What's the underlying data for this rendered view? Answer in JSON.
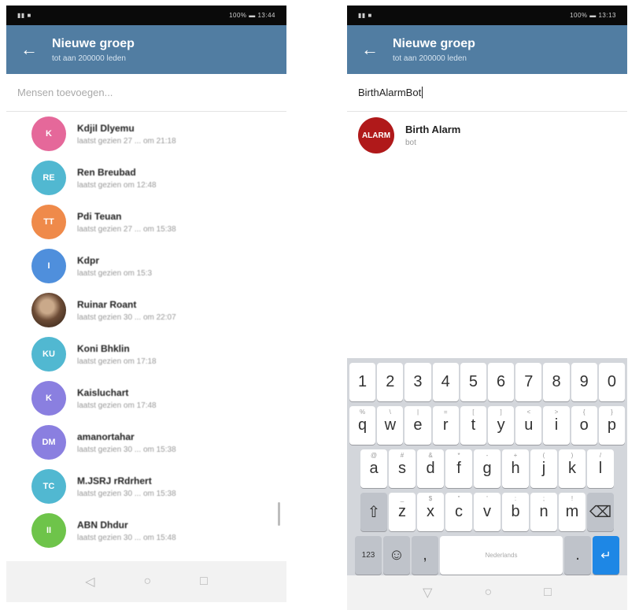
{
  "left_screen": {
    "statusbar": {
      "left": "▮▮ ■",
      "right": "100% ▬ 13:44"
    },
    "header": {
      "title": "Nieuwe groep",
      "subtitle": "tot aan 200000 leden"
    },
    "search": {
      "placeholder": "Mensen toevoegen..."
    },
    "contacts": [
      {
        "initials": "K",
        "color": "#e5689a",
        "name": "Kdjil Dlyemu",
        "status": "laatst gezien 27 ... om 21:18"
      },
      {
        "initials": "RE",
        "color": "#51b8d1",
        "name": "Ren Breubad",
        "status": "laatst gezien om 12:48"
      },
      {
        "initials": "TT",
        "color": "#ef8a4a",
        "name": "Pdi Teuan",
        "status": "laatst gezien 27 ... om 15:38"
      },
      {
        "initials": "I",
        "color": "#4f8fdc",
        "name": "Kdpr",
        "status": "laatst gezien om 15:3"
      },
      {
        "initials": "",
        "color": "",
        "name": "Ruinar Roant",
        "status": "laatst gezien 30 ... om 22:07"
      },
      {
        "initials": "KU",
        "color": "#51b8d1",
        "name": "Koni Bhklin",
        "status": "laatst gezien om 17:18"
      },
      {
        "initials": "K",
        "color": "#8a7fe0",
        "name": "Kaisluchart",
        "status": "laatst gezien om 17:48"
      },
      {
        "initials": "DM",
        "color": "#8a7fe0",
        "name": "amanortahar",
        "status": "laatst gezien 30 ... om 15:38"
      },
      {
        "initials": "TC",
        "color": "#51b8d1",
        "name": "M.JSRJ rRdrhert",
        "status": "laatst gezien 30 ... om 15:38"
      },
      {
        "initials": "II",
        "color": "#6ec44a",
        "name": "ABN Dhdur",
        "status": "laatst gezien 30 ... om 15:48"
      }
    ],
    "nav": {
      "back": "◁",
      "home": "○",
      "recent": "□"
    }
  },
  "right_screen": {
    "statusbar": {
      "left": "▮▮ ■",
      "right": "100% ▬ 13:13"
    },
    "header": {
      "title": "Nieuwe groep",
      "subtitle": "tot aan 200000 leden"
    },
    "search": {
      "value": "BirthAlarmBot"
    },
    "result": {
      "avatar_text": "ALARM",
      "name": "Birth Alarm",
      "subtitle": "bot"
    },
    "keyboard": {
      "numbers": [
        "1",
        "2",
        "3",
        "4",
        "5",
        "6",
        "7",
        "8",
        "9",
        "0"
      ],
      "row1": [
        {
          "k": "q",
          "h": "%"
        },
        {
          "k": "w",
          "h": "\\"
        },
        {
          "k": "e",
          "h": "|"
        },
        {
          "k": "r",
          "h": "="
        },
        {
          "k": "t",
          "h": "["
        },
        {
          "k": "y",
          "h": "]"
        },
        {
          "k": "u",
          "h": "<"
        },
        {
          "k": "i",
          "h": ">"
        },
        {
          "k": "o",
          "h": "{"
        },
        {
          "k": "p",
          "h": "}"
        }
      ],
      "row2": [
        {
          "k": "a",
          "h": "@"
        },
        {
          "k": "s",
          "h": "#"
        },
        {
          "k": "d",
          "h": "&"
        },
        {
          "k": "f",
          "h": "*"
        },
        {
          "k": "g",
          "h": "-"
        },
        {
          "k": "h",
          "h": "+"
        },
        {
          "k": "j",
          "h": "("
        },
        {
          "k": "k",
          "h": ")"
        },
        {
          "k": "l",
          "h": "/"
        }
      ],
      "row3": [
        {
          "k": "z",
          "h": "_"
        },
        {
          "k": "x",
          "h": "$"
        },
        {
          "k": "c",
          "h": "\""
        },
        {
          "k": "v",
          "h": "'"
        },
        {
          "k": "b",
          "h": ":"
        },
        {
          "k": "n",
          "h": ";"
        },
        {
          "k": "m",
          "h": "!"
        }
      ],
      "shift": "⇧",
      "backspace": "⌫",
      "symbols": "123",
      "emoji": "☺",
      "comma": ",",
      "space": "Nederlands",
      "period": ".",
      "enter": "↵"
    },
    "nav": {
      "back": "▽",
      "home": "○",
      "recent": "□"
    }
  }
}
